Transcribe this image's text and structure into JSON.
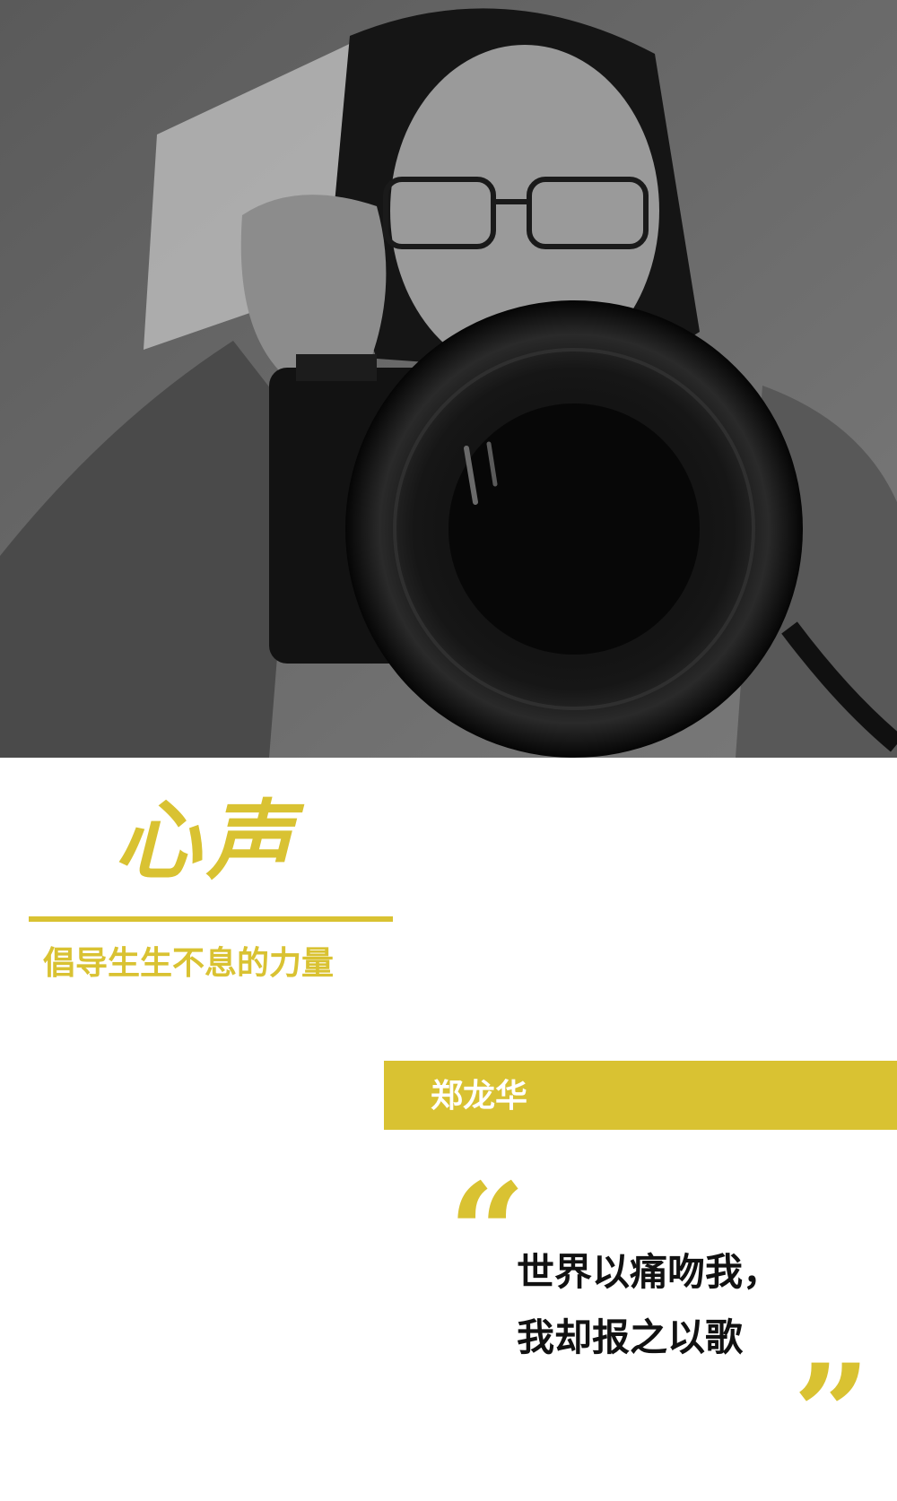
{
  "heading": "心声",
  "tagline": "倡导生生不息的力量",
  "name": "郑龙华",
  "quote": {
    "open_mark": "“",
    "line1": "世界以痛吻我，",
    "line2": "我却报之以歌",
    "close_mark": "”"
  },
  "colors": {
    "accent": "#d9c232",
    "text": "#111111",
    "background": "#ffffff"
  }
}
